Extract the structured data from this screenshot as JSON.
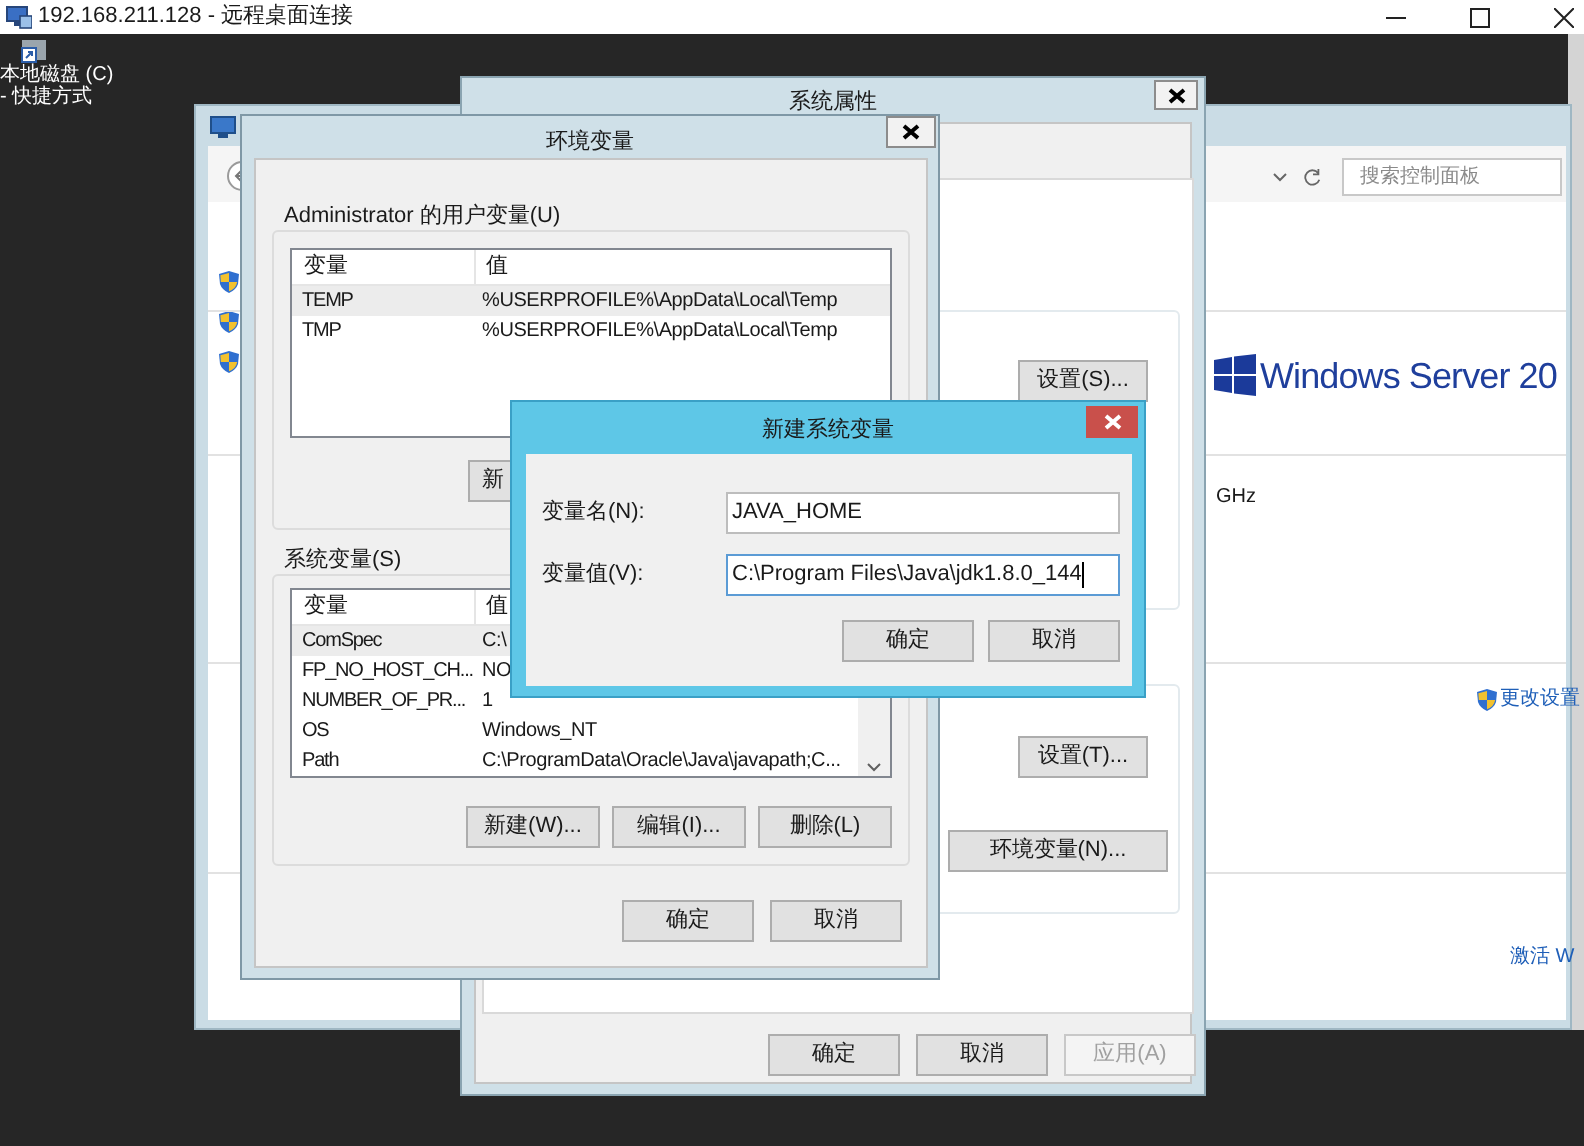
{
  "remote_window": {
    "title": "192.168.211.128 - 远程桌面连接"
  },
  "desktop_icon": {
    "label_lines": [
      "本地磁盘 (C)",
      "- 快捷方式"
    ]
  },
  "control_panel": {
    "search": {
      "placeholder": "搜索控制面板"
    },
    "logo_text": "Windows Server 20",
    "cpu_text": "GHz",
    "links": [
      "更改设置",
      "激活 W"
    ]
  },
  "system_properties": {
    "title": "系统属性",
    "buttons": [
      "设置(S)...",
      "设置(T)...",
      "环境变量(N)..."
    ],
    "footer_buttons": [
      {
        "label": "确定",
        "disabled": false
      },
      {
        "label": "取消",
        "disabled": false
      },
      {
        "label": "应用(A)",
        "disabled": true
      }
    ]
  },
  "environment_variables": {
    "title": "环境变量",
    "user_group": {
      "label": "Administrator 的用户变量(U)",
      "columns": [
        "变量",
        "值"
      ],
      "rows": [
        {
          "name": "TEMP",
          "value": "%USERPROFILE%\\AppData\\Local\\Temp",
          "selected": true
        },
        {
          "name": "TMP",
          "value": "%USERPROFILE%\\AppData\\Local\\Temp",
          "selected": false
        }
      ],
      "buttons": [
        "新"
      ]
    },
    "system_group": {
      "label": "系统变量(S)",
      "columns": [
        "变量",
        "值"
      ],
      "rows": [
        {
          "name": "ComSpec",
          "value": "C:\\",
          "selected": true
        },
        {
          "name": "FP_NO_HOST_CH...",
          "value": "NO",
          "selected": false
        },
        {
          "name": "NUMBER_OF_PR...",
          "value": "1",
          "selected": false
        },
        {
          "name": "OS",
          "value": "Windows_NT",
          "selected": false
        },
        {
          "name": "Path",
          "value": "C:\\ProgramData\\Oracle\\Java\\javapath;C...",
          "selected": false
        }
      ],
      "buttons": [
        "新建(W)...",
        "编辑(I)...",
        "删除(L)"
      ]
    },
    "footer_buttons": [
      "确定",
      "取消"
    ]
  },
  "new_variable_dialog": {
    "title": "新建系统变量",
    "fields": [
      {
        "label": "变量名(N):",
        "value": "JAVA_HOME",
        "focused": false
      },
      {
        "label": "变量值(V):",
        "value": "C:\\Program Files\\Java\\jdk1.8.0_144",
        "focused": true
      }
    ],
    "buttons": [
      "确定",
      "取消"
    ]
  }
}
